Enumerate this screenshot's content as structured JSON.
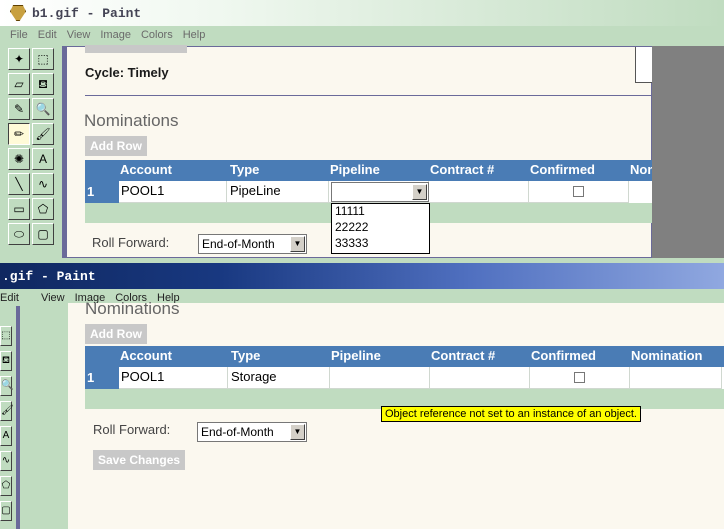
{
  "window1": {
    "title": "b1.gif - Paint",
    "menu": [
      "File",
      "Edit",
      "View",
      "Image",
      "Colors",
      "Help"
    ],
    "cycle_label": "Cycle: Timely",
    "nominations_heading": "Nominations",
    "add_row_label": "Add Row",
    "columns": [
      "Account",
      "Type",
      "Pipeline",
      "Contract #",
      "Confirmed",
      "Nom"
    ],
    "row": {
      "num": "1",
      "account": "POOL1",
      "type": "PipeLine",
      "pipeline": ""
    },
    "pipeline_options": [
      "11111",
      "22222",
      "33333"
    ],
    "roll_forward_label": "Roll Forward:",
    "roll_forward_value": "End-of-Month"
  },
  "window2": {
    "title": ".gif - Paint",
    "menu": [
      "Edit",
      "View",
      "Image",
      "Colors",
      "Help"
    ],
    "nominations_heading": "Nominations",
    "add_row_label": "Add Row",
    "columns": [
      "Account",
      "Type",
      "Pipeline",
      "Contract #",
      "Confirmed",
      "Nomination"
    ],
    "row": {
      "num": "1",
      "account": "POOL1",
      "type": "Storage"
    },
    "error_tooltip": "Object reference not set to an instance of an object.",
    "roll_forward_label": "Roll Forward:",
    "roll_forward_value": "End-of-Month",
    "save_changes_label": "Save Changes"
  },
  "tools": [
    "free-select",
    "rect-select",
    "eraser",
    "fill",
    "picker",
    "magnifier",
    "pencil",
    "brush",
    "airbrush",
    "text",
    "line",
    "curve",
    "rectangle",
    "polygon",
    "ellipse",
    "rounded-rect"
  ],
  "tool_glyphs": [
    "✦",
    "⬚",
    "▱",
    "⛾",
    "✎",
    "🔍",
    "✏",
    "🖌",
    "✺",
    "A",
    "╲",
    "∿",
    "▭",
    "⬠",
    "⬭",
    "▢"
  ]
}
